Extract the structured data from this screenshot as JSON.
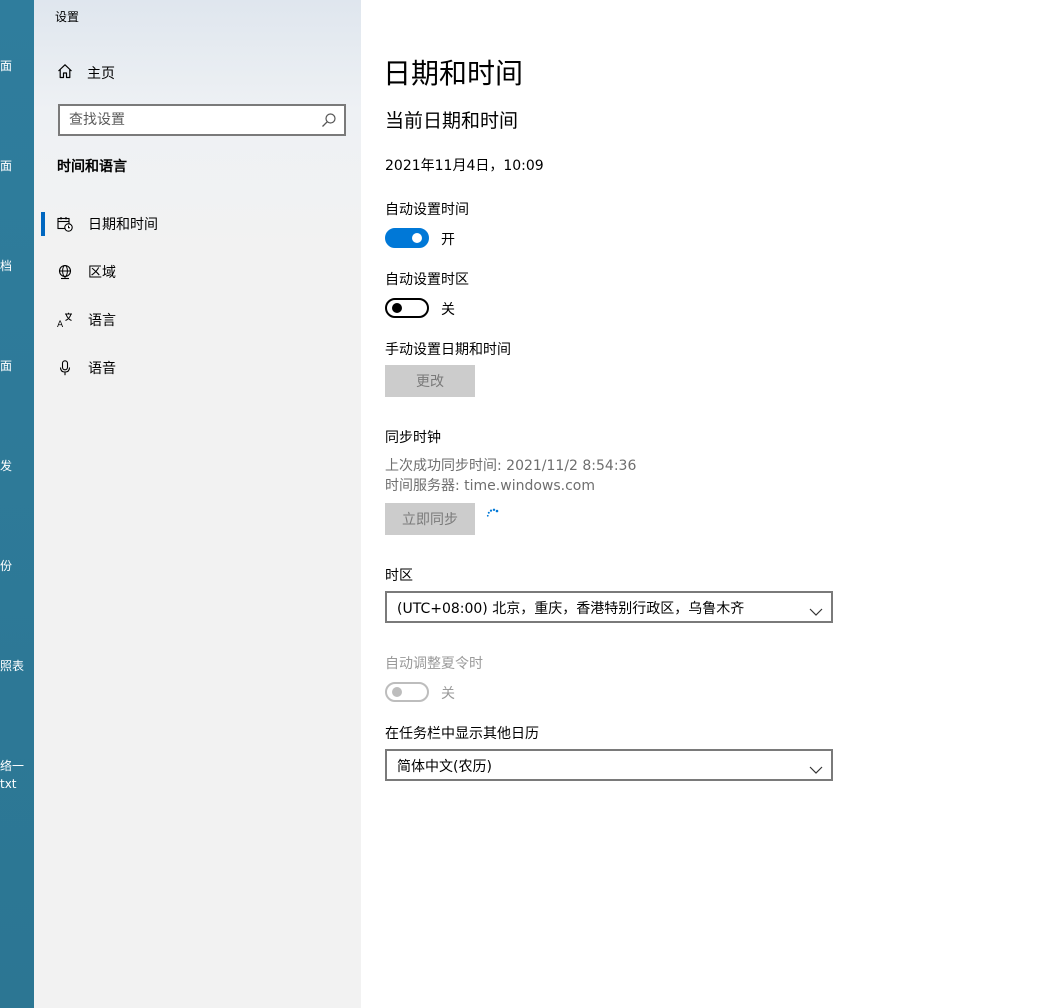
{
  "desktop": {
    "labels": [
      "面",
      "面",
      "档",
      "面",
      "发",
      "份",
      "照表",
      "络一",
      "txt"
    ]
  },
  "sidebar": {
    "app_title": "设置",
    "home_label": "主页",
    "search_placeholder": "查找设置",
    "section_title": "时间和语言",
    "items": [
      {
        "label": "日期和时间",
        "icon": "calendar-clock-icon",
        "active": true
      },
      {
        "label": "区域",
        "icon": "globe-icon",
        "active": false
      },
      {
        "label": "语言",
        "icon": "language-icon",
        "active": false
      },
      {
        "label": "语音",
        "icon": "microphone-icon",
        "active": false
      }
    ]
  },
  "main": {
    "title": "日期和时间",
    "subtitle": "当前日期和时间",
    "current_datetime": "2021年11月4日，10:09",
    "auto_time": {
      "label": "自动设置时间",
      "state": "开",
      "on": true
    },
    "auto_timezone": {
      "label": "自动设置时区",
      "state": "关",
      "on": false
    },
    "manual": {
      "label": "手动设置日期和时间",
      "button": "更改"
    },
    "sync": {
      "label": "同步时钟",
      "last_sync": "上次成功同步时间: 2021/11/2 8:54:36",
      "server": "时间服务器: time.windows.com",
      "button": "立即同步"
    },
    "timezone": {
      "label": "时区",
      "value": "(UTC+08:00) 北京，重庆，香港特别行政区，乌鲁木齐"
    },
    "dst": {
      "label": "自动调整夏令时",
      "state": "关",
      "on": false,
      "disabled": true
    },
    "calendar": {
      "label": "在任务栏中显示其他日历",
      "value": "简体中文(农历)"
    }
  },
  "colors": {
    "accent": "#0078d7",
    "nav_indicator": "#0067c0",
    "desktop_bg": "#2f7d9d",
    "button_disabled_bg": "#cccccc"
  }
}
